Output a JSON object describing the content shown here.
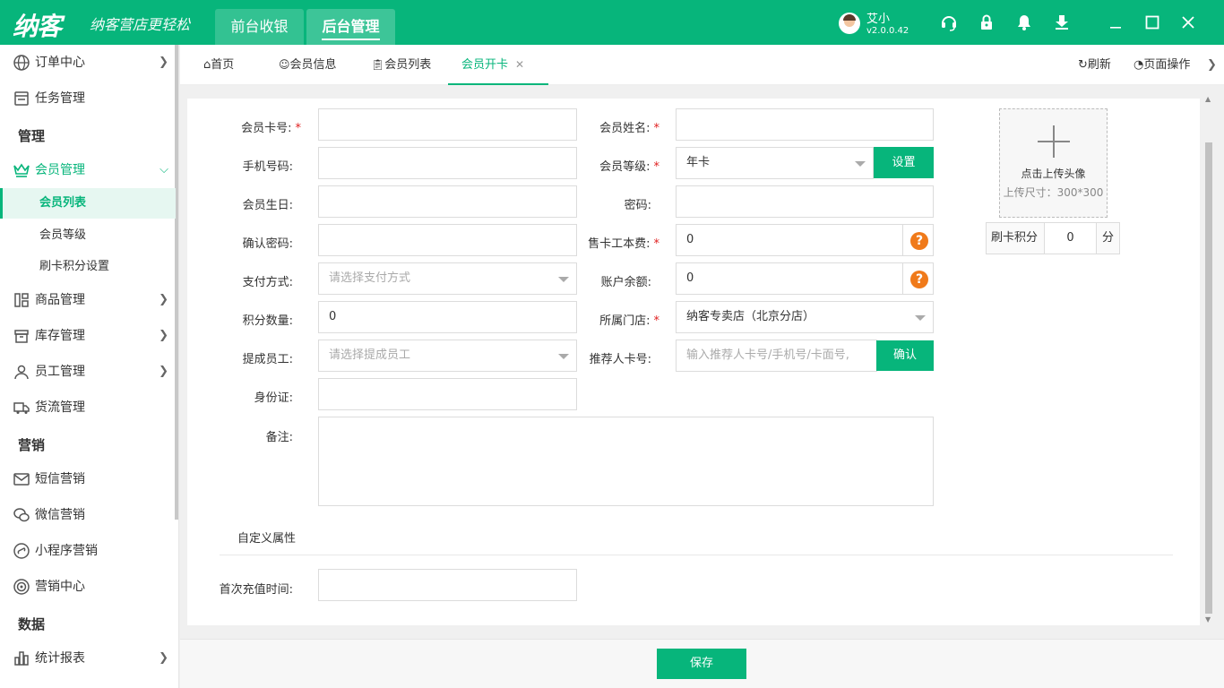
{
  "topbar": {
    "logo": "纳客",
    "slogan": "纳客营店更轻松",
    "tabs": [
      {
        "label": "前台收银"
      },
      {
        "label": "后台管理"
      }
    ],
    "user": {
      "name": "艾小",
      "version": "v2.0.0.42"
    },
    "icons": [
      "headset-icon",
      "lock-icon",
      "bell-icon",
      "download-icon",
      "minimize-icon",
      "maximize-icon",
      "close-icon"
    ]
  },
  "sidebar": {
    "items": {
      "orders": "订单中心",
      "tasks": "任务管理",
      "manage_header": "管理",
      "members": "会员管理",
      "member_list": "会员列表",
      "member_level": "会员等级",
      "card_points": "刷卡积分设置",
      "goods": "商品管理",
      "stock": "库存管理",
      "staff": "员工管理",
      "logistics": "货流管理",
      "marketing_header": "营销",
      "sms": "短信营销",
      "wechat": "微信营销",
      "miniapp": "小程序营销",
      "marketing_center": "营销中心",
      "data_header": "数据",
      "reports": "统计报表"
    }
  },
  "tabs": {
    "home": "首页",
    "member_info": "会员信息",
    "member_list": "会员列表",
    "member_open": "会员开卡",
    "refresh": "刷新",
    "page_ops": "页面操作"
  },
  "form": {
    "card_no": {
      "label": "会员卡号:",
      "value": ""
    },
    "name": {
      "label": "会员姓名:",
      "value": ""
    },
    "phone": {
      "label": "手机号码:",
      "value": ""
    },
    "level": {
      "label": "会员等级:",
      "value": "年卡",
      "button": "设置"
    },
    "birthday": {
      "label": "会员生日:",
      "value": ""
    },
    "password": {
      "label": "密码:",
      "value": ""
    },
    "confirm_password": {
      "label": "确认密码:",
      "value": ""
    },
    "card_fee": {
      "label": "售卡工本费:",
      "value": "0"
    },
    "payment": {
      "label": "支付方式:",
      "placeholder": "请选择支付方式"
    },
    "balance": {
      "label": "账户余额:",
      "value": "0"
    },
    "points": {
      "label": "积分数量:",
      "value": "0"
    },
    "store": {
      "label": "所属门店:",
      "value": "纳客专卖店（北京分店）"
    },
    "commission_staff": {
      "label": "提成员工:",
      "placeholder": "请选择提成员工"
    },
    "referrer": {
      "label": "推荐人卡号:",
      "placeholder": "输入推荐人卡号/手机号/卡面号,",
      "button": "确认"
    },
    "id_card": {
      "label": "身份证:",
      "value": ""
    },
    "remark": {
      "label": "备注:",
      "value": ""
    },
    "custom_attrs": "自定义属性",
    "first_recharge": {
      "label": "首次充值时间:",
      "value": ""
    },
    "upload": {
      "line1": "点击上传头像",
      "line2": "上传尺寸：300*300"
    },
    "swipe_points": {
      "label": "刷卡积分",
      "value": "0",
      "unit": "分"
    },
    "help_mark": "?",
    "required_mark": "*"
  },
  "footer": {
    "save": "保存"
  }
}
